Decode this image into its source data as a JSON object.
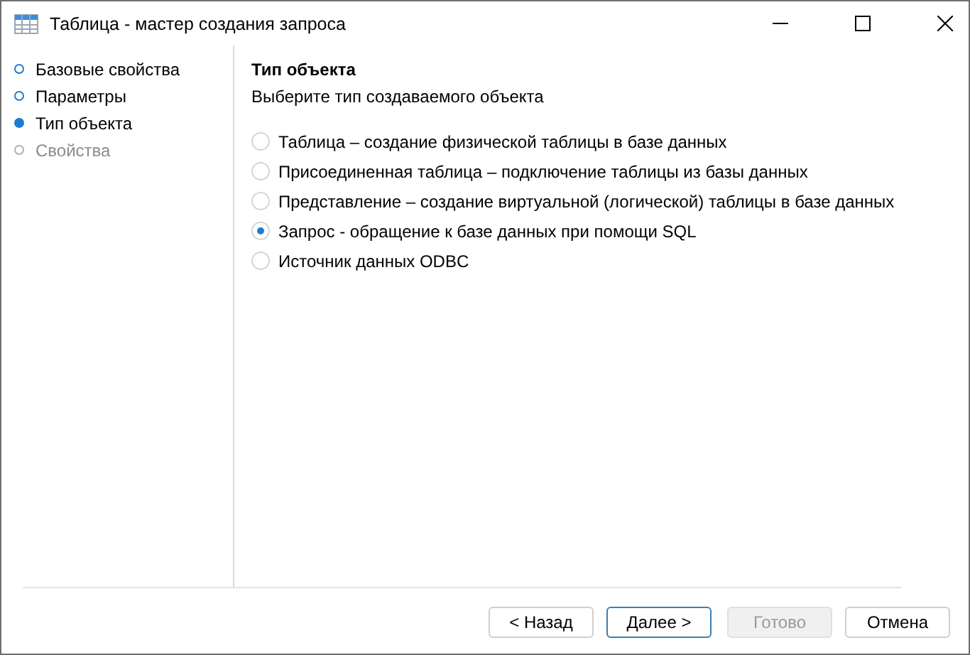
{
  "window": {
    "title": "Таблица - мастер создания запроса"
  },
  "steps": [
    {
      "label": "Базовые свойства",
      "selected": false,
      "disabled": false
    },
    {
      "label": "Параметры",
      "selected": false,
      "disabled": false
    },
    {
      "label": "Тип объекта",
      "selected": true,
      "disabled": false
    },
    {
      "label": "Свойства",
      "selected": false,
      "disabled": true
    }
  ],
  "page": {
    "heading": "Тип объекта",
    "description": "Выберите тип создаваемого объекта",
    "options": [
      {
        "label": "Таблица – создание физической таблицы в базе данных",
        "selected": false
      },
      {
        "label": "Присоединенная таблица – подключение таблицы из базы данных",
        "selected": false
      },
      {
        "label": "Представление – создание виртуальной (логической) таблицы в базе данных",
        "selected": false
      },
      {
        "label": "Запрос - обращение к базе данных при помощи SQL",
        "selected": true
      },
      {
        "label": "Источник данных ODBC",
        "selected": false
      }
    ]
  },
  "buttons": [
    {
      "label": "< Назад",
      "default": false,
      "disabled": false
    },
    {
      "label": "Далее >",
      "default": true,
      "disabled": false
    },
    {
      "label": "Готово",
      "default": false,
      "disabled": true
    },
    {
      "label": "Отмена",
      "default": false,
      "disabled": false
    }
  ]
}
